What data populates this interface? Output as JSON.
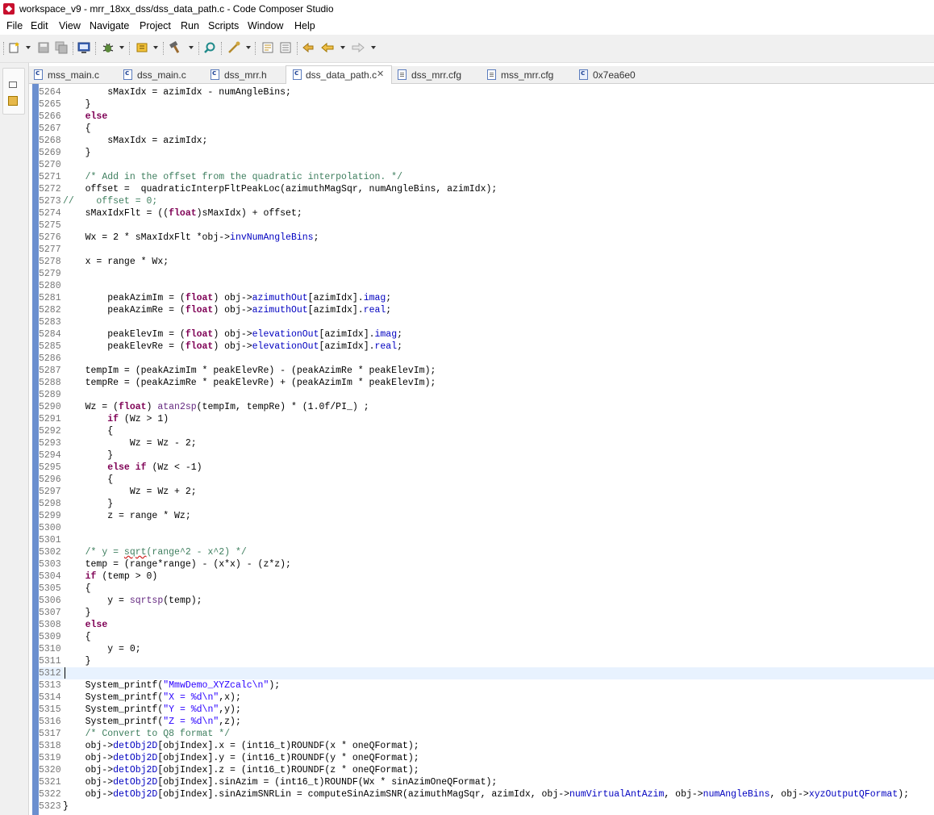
{
  "window": {
    "title": "workspace_v9 - mrr_18xx_dss/dss_data_path.c - Code Composer Studio"
  },
  "menu": [
    "File",
    "Edit",
    "View",
    "Navigate",
    "Project",
    "Run",
    "Scripts",
    "Window",
    "Help"
  ],
  "toolbar": {
    "icons": [
      "new-icon",
      "save-icon",
      "save-all-icon",
      "terminal-icon",
      "debug-icon",
      "flash-icon",
      "build-icon",
      "search-icon",
      "run-icon",
      "annotation-icon",
      "task-icon",
      "prev-annotation-icon",
      "back-icon",
      "forward-icon"
    ]
  },
  "tabs": [
    {
      "label": "mss_main.c",
      "active": false
    },
    {
      "label": "dss_main.c",
      "active": false
    },
    {
      "label": "dss_mrr.h",
      "active": false
    },
    {
      "label": "dss_data_path.c",
      "active": true
    },
    {
      "label": "dss_mrr.cfg",
      "active": false
    },
    {
      "label": "mss_mrr.cfg",
      "active": false
    },
    {
      "label": "0x7ea6e0",
      "active": false
    }
  ],
  "editor": {
    "current_line": "5312",
    "lines": [
      {
        "n": "5264",
        "t": "        sMaxIdx = azimIdx - numAngleBins;"
      },
      {
        "n": "5265",
        "t": "    }"
      },
      {
        "n": "5266",
        "t": "    else"
      },
      {
        "n": "5267",
        "t": "    {"
      },
      {
        "n": "5268",
        "t": "        sMaxIdx = azimIdx;"
      },
      {
        "n": "5269",
        "t": "    }"
      },
      {
        "n": "5270",
        "t": ""
      },
      {
        "n": "5271",
        "t": "    /* Add in the offset from the quadratic interpolation. */"
      },
      {
        "n": "5272",
        "t": "    offset =  quadraticInterpFltPeakLoc(azimuthMagSqr, numAngleBins, azimIdx);"
      },
      {
        "n": "5273",
        "t": "//    offset = 0;"
      },
      {
        "n": "5274",
        "t": "    sMaxIdxFlt = ((float)sMaxIdx) + offset;"
      },
      {
        "n": "5275",
        "t": ""
      },
      {
        "n": "5276",
        "t": "    Wx = 2 * sMaxIdxFlt *obj->invNumAngleBins;"
      },
      {
        "n": "5277",
        "t": ""
      },
      {
        "n": "5278",
        "t": "    x = range * Wx;"
      },
      {
        "n": "5279",
        "t": ""
      },
      {
        "n": "5280",
        "t": ""
      },
      {
        "n": "5281",
        "t": "        peakAzimIm = (float) obj->azimuthOut[azimIdx].imag;"
      },
      {
        "n": "5282",
        "t": "        peakAzimRe = (float) obj->azimuthOut[azimIdx].real;"
      },
      {
        "n": "5283",
        "t": ""
      },
      {
        "n": "5284",
        "t": "        peakElevIm = (float) obj->elevationOut[azimIdx].imag;"
      },
      {
        "n": "5285",
        "t": "        peakElevRe = (float) obj->elevationOut[azimIdx].real;"
      },
      {
        "n": "5286",
        "t": ""
      },
      {
        "n": "5287",
        "t": "    tempIm = (peakAzimIm * peakElevRe) - (peakAzimRe * peakElevIm);"
      },
      {
        "n": "5288",
        "t": "    tempRe = (peakAzimRe * peakElevRe) + (peakAzimIm * peakElevIm);"
      },
      {
        "n": "5289",
        "t": ""
      },
      {
        "n": "5290",
        "t": "    Wz = (float) atan2sp(tempIm, tempRe) * (1.0f/PI_) ;"
      },
      {
        "n": "5291",
        "t": "        if (Wz > 1)"
      },
      {
        "n": "5292",
        "t": "        {"
      },
      {
        "n": "5293",
        "t": "            Wz = Wz - 2;"
      },
      {
        "n": "5294",
        "t": "        }"
      },
      {
        "n": "5295",
        "t": "        else if (Wz < -1)"
      },
      {
        "n": "5296",
        "t": "        {"
      },
      {
        "n": "5297",
        "t": "            Wz = Wz + 2;"
      },
      {
        "n": "5298",
        "t": "        }"
      },
      {
        "n": "5299",
        "t": "        z = range * Wz;"
      },
      {
        "n": "5300",
        "t": ""
      },
      {
        "n": "5301",
        "t": ""
      },
      {
        "n": "5302",
        "t": "    /* y = sqrt(range^2 - x^2) */"
      },
      {
        "n": "5303",
        "t": "    temp = (range*range) - (x*x) - (z*z);"
      },
      {
        "n": "5304",
        "t": "    if (temp > 0)"
      },
      {
        "n": "5305",
        "t": "    {"
      },
      {
        "n": "5306",
        "t": "        y = sqrtsp(temp);"
      },
      {
        "n": "5307",
        "t": "    }"
      },
      {
        "n": "5308",
        "t": "    else"
      },
      {
        "n": "5309",
        "t": "    {"
      },
      {
        "n": "5310",
        "t": "        y = 0;"
      },
      {
        "n": "5311",
        "t": "    }"
      },
      {
        "n": "5312",
        "t": ""
      },
      {
        "n": "5313",
        "t": "    System_printf(\"MmwDemo_XYZcalc\\n\");"
      },
      {
        "n": "5314",
        "t": "    System_printf(\"X = %d\\n\",x);"
      },
      {
        "n": "5315",
        "t": "    System_printf(\"Y = %d\\n\",y);"
      },
      {
        "n": "5316",
        "t": "    System_printf(\"Z = %d\\n\",z);"
      },
      {
        "n": "5317",
        "t": "    /* Convert to Q8 format */"
      },
      {
        "n": "5318",
        "t": "    obj->detObj2D[objIndex].x = (int16_t)ROUNDF(x * oneQFormat);"
      },
      {
        "n": "5319",
        "t": "    obj->detObj2D[objIndex].y = (int16_t)ROUNDF(y * oneQFormat);"
      },
      {
        "n": "5320",
        "t": "    obj->detObj2D[objIndex].z = (int16_t)ROUNDF(z * oneQFormat);"
      },
      {
        "n": "5321",
        "t": "    obj->detObj2D[objIndex].sinAzim = (int16_t)ROUNDF(Wx * sinAzimOneQFormat);"
      },
      {
        "n": "5322",
        "t": "    obj->detObj2D[objIndex].sinAzimSNRLin = computeSinAzimSNR(azimuthMagSqr, azimIdx, obj->numVirtualAntAzim, obj->numAngleBins, obj->xyzOutputQFormat);"
      },
      {
        "n": "5323",
        "t": "}"
      }
    ]
  }
}
